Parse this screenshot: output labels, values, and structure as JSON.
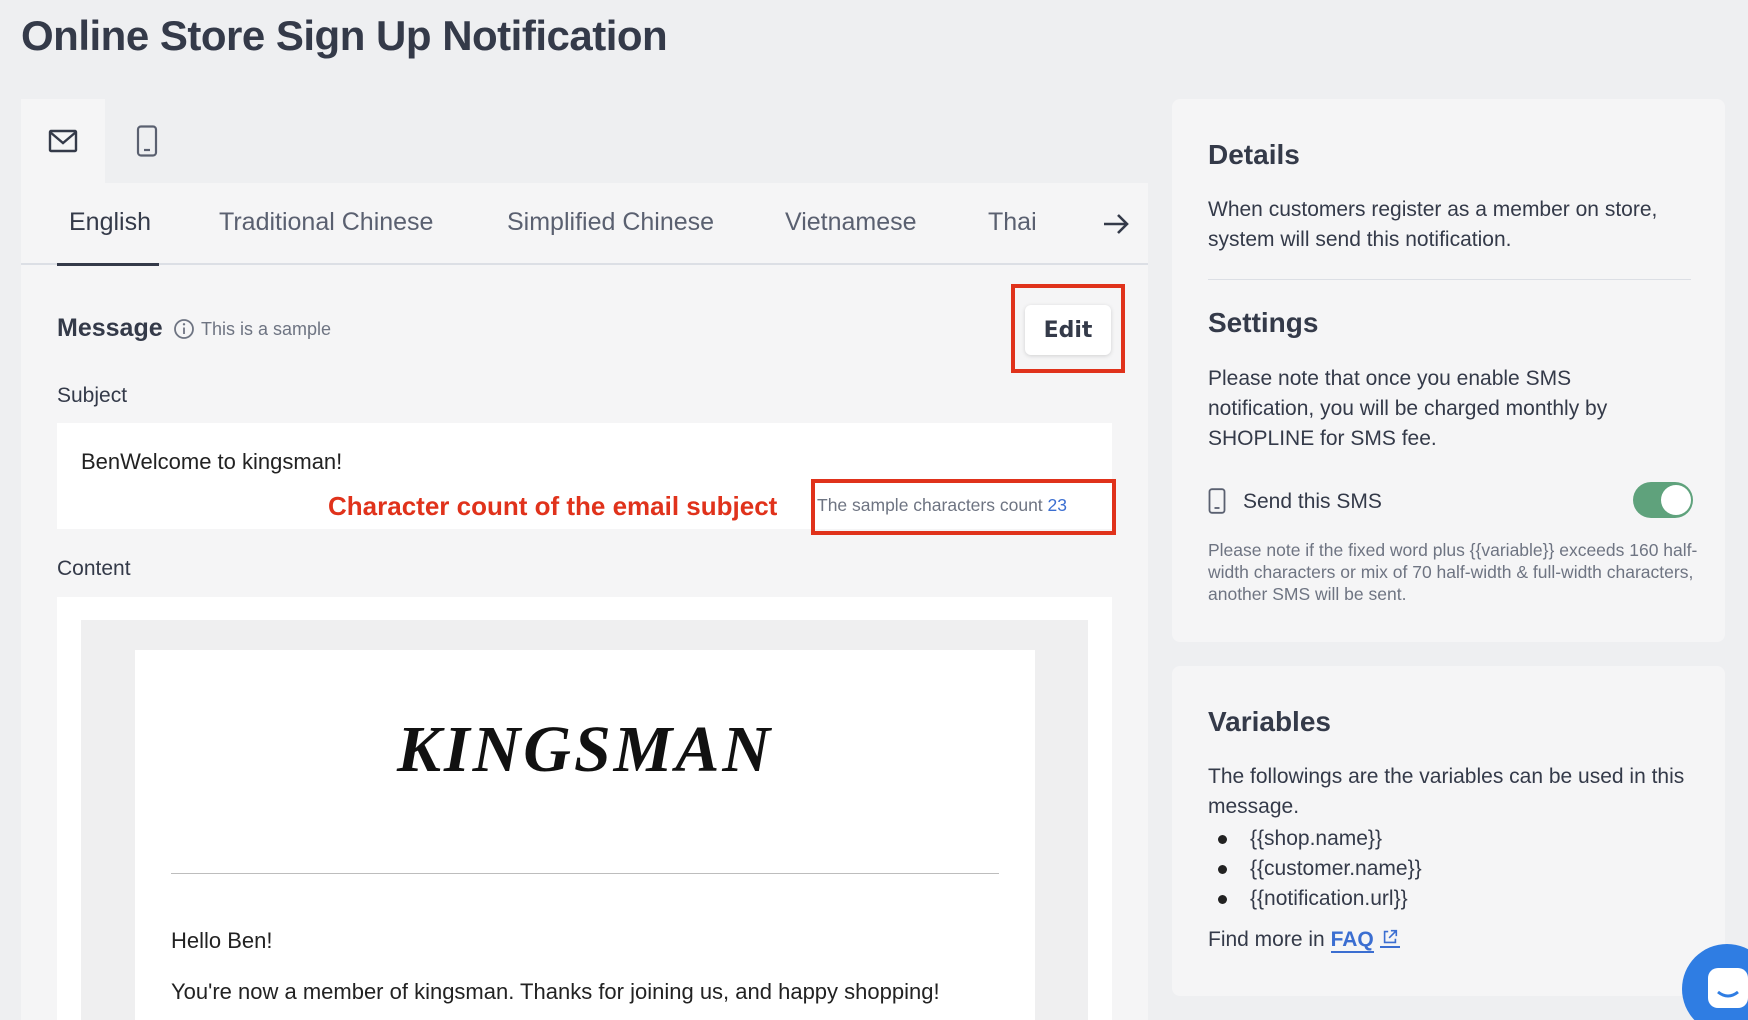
{
  "page": {
    "title": "Online Store Sign Up Notification"
  },
  "channels": [
    {
      "icon": "envelope-icon",
      "active": true
    },
    {
      "icon": "mobile-phone-icon",
      "active": false
    }
  ],
  "languages": {
    "tabs": [
      "English",
      "Traditional Chinese",
      "Simplified Chinese",
      "Vietnamese",
      "Thai"
    ],
    "active": "English",
    "next_icon": "arrow-right-icon"
  },
  "message": {
    "label": "Message",
    "sample_note": "This is a sample",
    "edit_label": "Edit",
    "subject_label": "Subject",
    "subject_value": "BenWelcome to kingsman!",
    "annotation": "Character count of the email subject",
    "count_label": "The sample characters count",
    "count_value": "23",
    "content_label": "Content"
  },
  "email": {
    "brand": "KINGSMAN",
    "greeting": "Hello Ben!",
    "body": "You're now a member of kingsman. Thanks for joining us, and happy shopping!"
  },
  "details": {
    "title": "Details",
    "text": "When customers register as a member on store, system will send this notification.",
    "settings_title": "Settings",
    "settings_text": "Please note that once you enable SMS notification, you will be charged monthly by SHOPLINE for SMS fee.",
    "sms_label": "Send this SMS",
    "sms_enabled": true,
    "sms_note": "Please note if the fixed word plus {{variable}} exceeds 160 half-width characters or mix of 70 half-width & full-width characters, another SMS will be sent."
  },
  "variables": {
    "title": "Variables",
    "intro": "The followings are the variables can be used in this message.",
    "items": [
      "{{shop.name}}",
      "{{customer.name}}",
      "{{notification.url}}"
    ],
    "faq_prefix": "Find more in",
    "faq_link": "FAQ"
  },
  "colors": {
    "accent": "#3b6ed1",
    "annotation_red": "#e0321b",
    "toggle_on": "#5fa27c"
  }
}
